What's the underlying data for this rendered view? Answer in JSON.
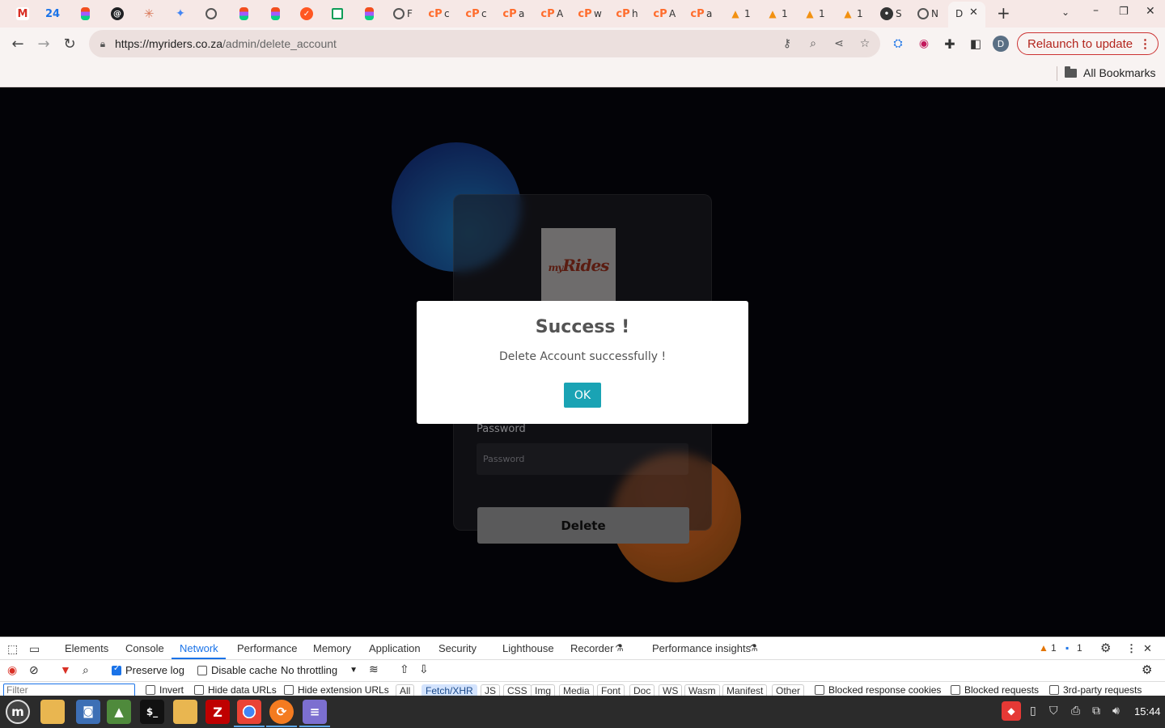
{
  "browser": {
    "tabs": [
      {
        "icon": "gmail-icon",
        "label": ""
      },
      {
        "icon": "news24-icon",
        "label": "24"
      },
      {
        "icon": "figma-icon",
        "label": ""
      },
      {
        "icon": "threads-icon",
        "label": ""
      },
      {
        "icon": "claude-icon",
        "label": ""
      },
      {
        "icon": "gemini-icon",
        "label": ""
      },
      {
        "icon": "globe-icon",
        "label": ""
      },
      {
        "icon": "figma-icon",
        "label": ""
      },
      {
        "icon": "figma-icon",
        "label": ""
      },
      {
        "icon": "orange-app-icon",
        "label": ""
      },
      {
        "icon": "sheets-icon",
        "label": ""
      },
      {
        "icon": "figma-icon",
        "label": ""
      },
      {
        "icon": "globe-icon",
        "label": "F"
      },
      {
        "icon": "cpanel-icon",
        "label": "c"
      },
      {
        "icon": "cpanel-icon",
        "label": "c"
      },
      {
        "icon": "cpanel-icon",
        "label": "a"
      },
      {
        "icon": "cpanel-icon",
        "label": "A"
      },
      {
        "icon": "cpanel-icon",
        "label": "w"
      },
      {
        "icon": "cpanel-icon",
        "label": "h"
      },
      {
        "icon": "cpanel-icon",
        "label": "A"
      },
      {
        "icon": "cpanel-icon",
        "label": "a"
      },
      {
        "icon": "phpmyadmin-icon",
        "label": "1"
      },
      {
        "icon": "phpmyadmin-icon",
        "label": "1"
      },
      {
        "icon": "phpmyadmin-icon",
        "label": "1"
      },
      {
        "icon": "phpmyadmin-icon",
        "label": "1"
      },
      {
        "icon": "spy-icon",
        "label": "S"
      },
      {
        "icon": "globe-icon",
        "label": "N"
      }
    ],
    "active_tab": {
      "label": "D",
      "close": "✕"
    },
    "new_tab": "+",
    "url": {
      "host": "https://myriders.co.za",
      "path": "/admin/delete_account"
    },
    "profile_initial": "D",
    "relaunch_label": "Relaunch to update",
    "bookmarks_all": "All Bookmarks"
  },
  "page": {
    "logo_text": {
      "prefix": "my",
      "main": "Rides"
    },
    "password_label": "Password",
    "password_placeholder": "Password",
    "delete_label": "Delete",
    "modal": {
      "title": "Success !",
      "message": "Delete Account successfully !",
      "ok_label": "OK"
    }
  },
  "devtools": {
    "tabs": [
      "Elements",
      "Console",
      "Network",
      "Performance",
      "Memory",
      "Application",
      "Security",
      "Lighthouse",
      "Recorder",
      "Performance insights"
    ],
    "active_tab": "Network",
    "warnings": "1",
    "messages": "1",
    "preserve_log": "Preserve log",
    "disable_cache": "Disable cache",
    "throttling": "No throttling",
    "filter_placeholder": "Filter",
    "invert": "Invert",
    "hide_data_urls": "Hide data URLs",
    "hide_extension_urls": "Hide extension URLs",
    "type_filters": [
      "All",
      "Fetch/XHR",
      "JS",
      "CSS",
      "Img",
      "Media",
      "Font",
      "Doc",
      "WS",
      "Wasm",
      "Manifest",
      "Other"
    ],
    "selected_filter": "Fetch/XHR",
    "blocked_cookies": "Blocked response cookies",
    "blocked_requests": "Blocked requests",
    "third_party": "3rd-party requests"
  },
  "taskbar": {
    "clock": "15:44"
  }
}
